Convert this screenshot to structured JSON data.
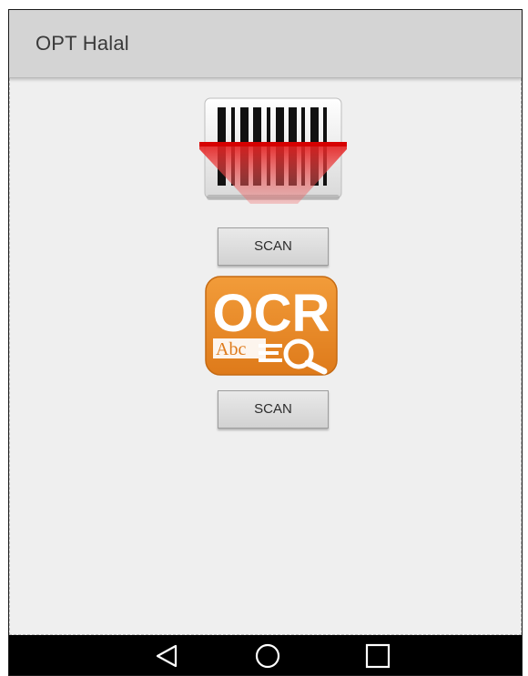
{
  "app_bar": {
    "title": "OPT Halal"
  },
  "barcode_section": {
    "icon": "barcode-scanner-icon",
    "button_label": "SCAN"
  },
  "ocr_section": {
    "icon": "ocr-icon",
    "icon_text": "OCR",
    "icon_subtext": "Abc",
    "button_label": "SCAN"
  },
  "nav_bar": {
    "back_icon": "back-triangle-icon",
    "home_icon": "home-circle-icon",
    "recents_icon": "recents-square-icon"
  },
  "colors": {
    "app_bar": "#d4d4d4",
    "content_bg": "#efefef",
    "ocr_orange": "#e8892a",
    "scan_red": "#e02020",
    "nav_bar": "#000000"
  }
}
